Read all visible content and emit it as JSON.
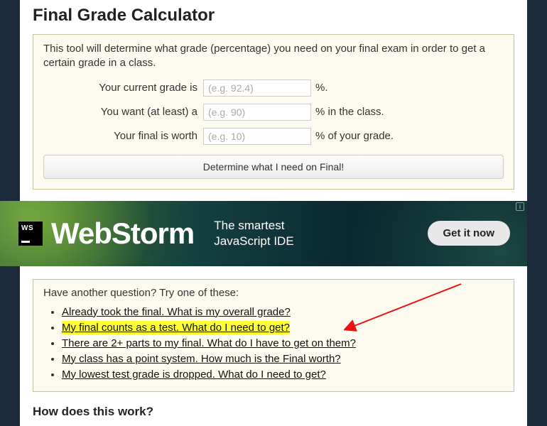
{
  "title": "Final Grade Calculator",
  "intro": "This tool will determine what grade (percentage) you need on your final exam in order to get a certain grade in a class.",
  "form": {
    "current_grade": {
      "label": "Your current grade is",
      "placeholder": "(e.g. 92.4)",
      "value": "",
      "suffix": "%."
    },
    "desired_grade": {
      "label": "You want (at least) a",
      "placeholder": "(e.g. 90)",
      "value": "",
      "suffix": "% in the class."
    },
    "final_worth": {
      "label": "Your final is worth",
      "placeholder": "(e.g. 10)",
      "value": "",
      "suffix": "% of your grade."
    },
    "submit_label": "Determine what I need on Final!"
  },
  "ad": {
    "logo_text": "WS",
    "brand": "WebStorm",
    "tagline_line1": "The smartest",
    "tagline_line2": "JavaScript IDE",
    "cta": "Get it now"
  },
  "questions": {
    "title": "Have another question? Try one of these:",
    "items": [
      {
        "text": "Already took the final. What is my overall grade?",
        "highlighted": false
      },
      {
        "text": "My final counts as a test. What do I need to get?",
        "highlighted": true
      },
      {
        "text": "There are 2+ parts to my final. What do I have to get on them?",
        "highlighted": false
      },
      {
        "text": "My class has a point system. How much is the Final worth?",
        "highlighted": false
      },
      {
        "text": "My lowest test grade is dropped. What do I need to get?",
        "highlighted": false
      }
    ]
  },
  "section_heading": "How does this work?"
}
